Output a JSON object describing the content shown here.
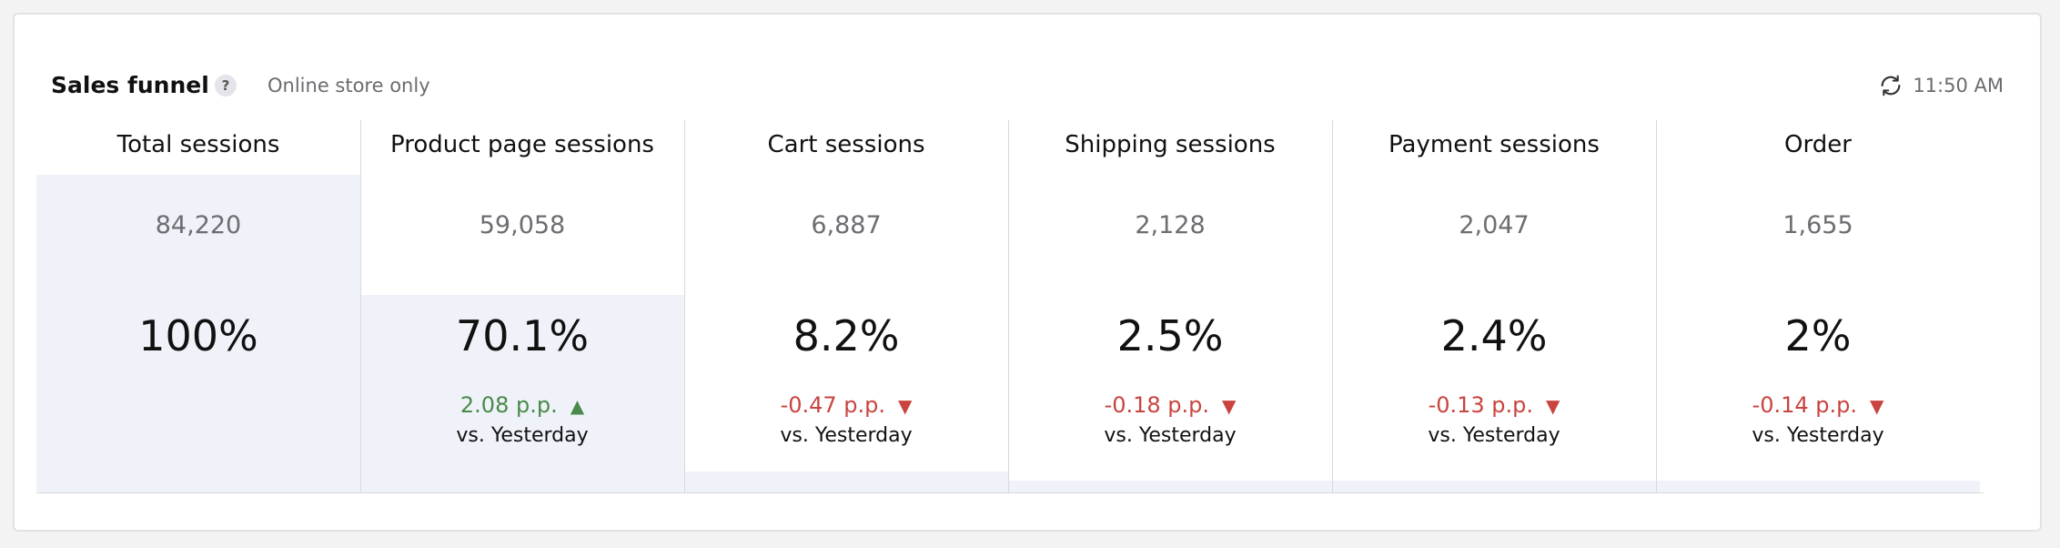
{
  "header": {
    "title": "Sales funnel",
    "help_glyph": "?",
    "subtitle": "Online store only",
    "refresh_icon": "refresh-icon",
    "time": "11:50 AM"
  },
  "colors": {
    "fill": "#f0f2f9",
    "positive": "#4a8a4a",
    "negative": "#c9443f",
    "divider": "#d9d9dd"
  },
  "stages": [
    {
      "title": "Total sessions",
      "count": "84,220",
      "pct": "100%",
      "share": 1.0,
      "delta": "",
      "direction": "",
      "compare": ""
    },
    {
      "title": "Product page sessions",
      "count": "59,058",
      "pct": "70.1%",
      "share": 0.701,
      "delta": "2.08 p.p.",
      "direction": "up",
      "compare": "vs. Yesterday"
    },
    {
      "title": "Cart sessions",
      "count": "6,887",
      "pct": "8.2%",
      "share": 0.082,
      "delta": "-0.47 p.p.",
      "direction": "down",
      "compare": "vs. Yesterday"
    },
    {
      "title": "Shipping sessions",
      "count": "2,128",
      "pct": "2.5%",
      "share": 0.025,
      "delta": "-0.18 p.p.",
      "direction": "down",
      "compare": "vs. Yesterday"
    },
    {
      "title": "Payment sessions",
      "count": "2,047",
      "pct": "2.4%",
      "share": 0.024,
      "delta": "-0.13 p.p.",
      "direction": "down",
      "compare": "vs. Yesterday"
    },
    {
      "title": "Order",
      "count": "1,655",
      "pct": "2%",
      "share": 0.02,
      "delta": "-0.14 p.p.",
      "direction": "down",
      "compare": "vs. Yesterday"
    }
  ]
}
